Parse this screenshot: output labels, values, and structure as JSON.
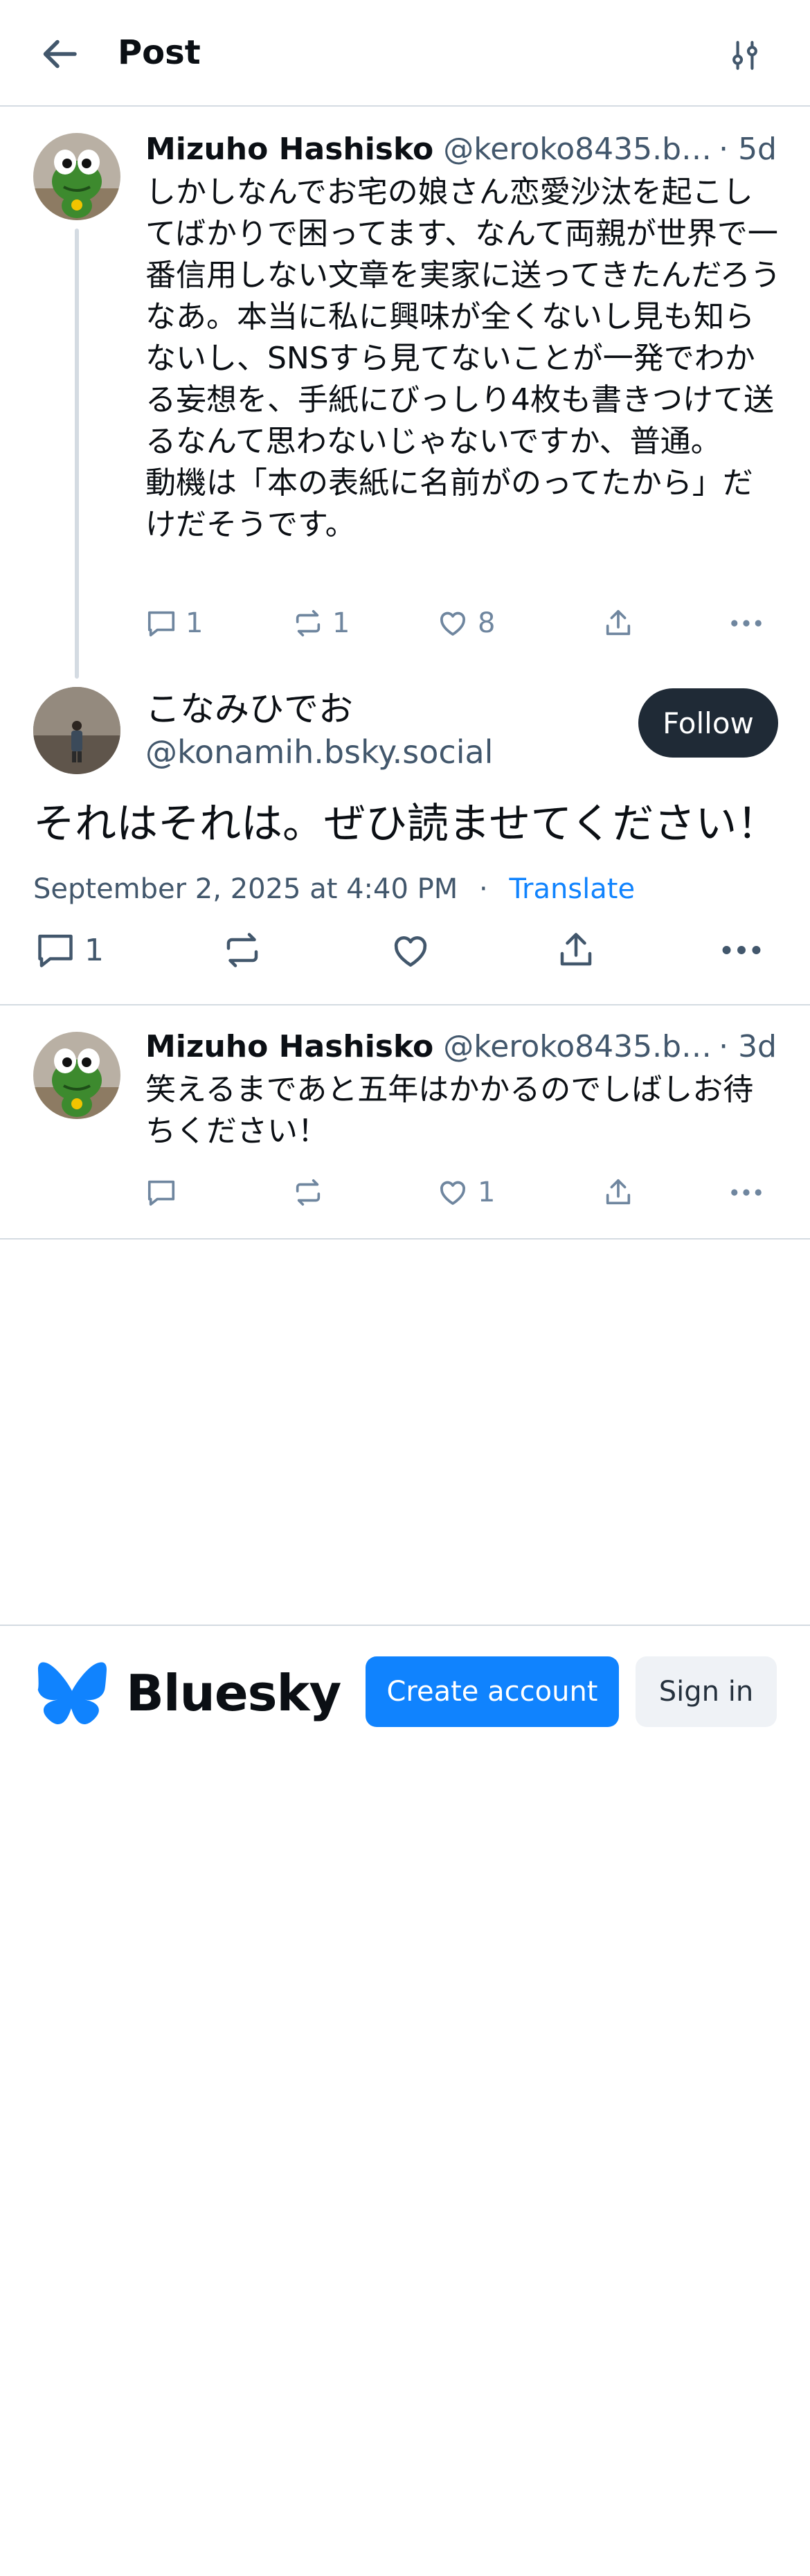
{
  "header": {
    "title": "Post",
    "back_icon": "arrow-left-icon",
    "filter_icon": "sliders-icon"
  },
  "parent_post": {
    "author_name": "Mizuho Hashisko",
    "author_handle": "@keroko8435.bsk...",
    "time": "· 5d",
    "text": "しかしなんでお宅の娘さん恋愛沙汰を起こしてばかりで困ってます、なんて両親が世界で一番信用しない文章を実家に送ってきたんだろうなあ。本当に私に興味が全くないし見も知らないし、SNSすら見てないことが一発でわかる妄想を、手紙にびっしり4枚も書きつけて送るなんて思わないじゃないですか、普通。\n動機は「本の表紙に名前がのってたから」だけだそうです。",
    "replies": "1",
    "reposts": "1",
    "likes": "8"
  },
  "main_post": {
    "author_name": "こなみひでお",
    "author_handle": "@konamih.bsky.social",
    "follow_label": "Follow",
    "text": "それはそれは。ぜひ読ませてください！",
    "date": "September 2, 2025 at 4:40 PM",
    "separator": "·",
    "translate_label": "Translate",
    "replies": "1"
  },
  "reply_post": {
    "author_name": "Mizuho Hashisko",
    "author_handle": "@keroko8435.bsk...",
    "time": "· 3d",
    "text": "笑えるまであと五年はかかるのでしばしお待ちください！",
    "likes": "1"
  },
  "footer": {
    "brand": "Bluesky",
    "create_account_label": "Create account",
    "sign_in_label": "Sign in"
  },
  "colors": {
    "accent": "#1083fe",
    "muted": "#6f869f",
    "border": "#d4dbe2",
    "follow_bg": "#1f2a36"
  }
}
